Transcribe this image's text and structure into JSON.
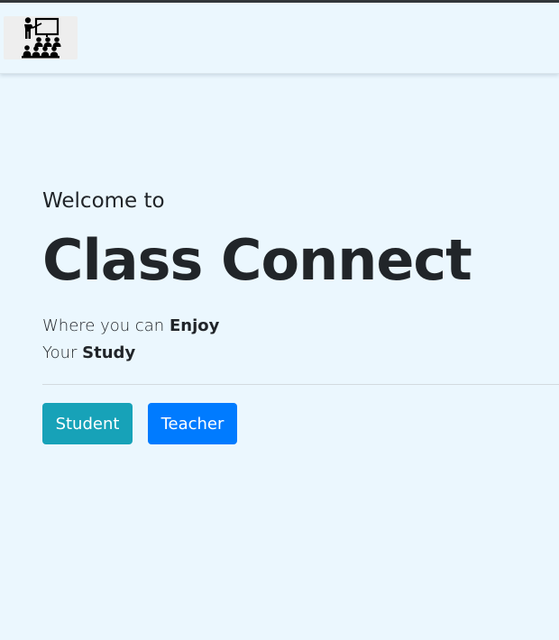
{
  "navbar": {
    "logo_icon": "classroom-teacher-icon"
  },
  "hero": {
    "welcome": "Welcome to",
    "title": "Class Connect",
    "line1_prefix": "Where you can",
    "line1_bold": "Enjoy",
    "line2_prefix": "Your",
    "line2_bold": "Study"
  },
  "buttons": {
    "student_label": "Student",
    "teacher_label": "Teacher"
  },
  "colors": {
    "background": "#ebf7fe",
    "student_button": "#17a2b8",
    "teacher_button": "#007bff",
    "text": "#212529"
  }
}
